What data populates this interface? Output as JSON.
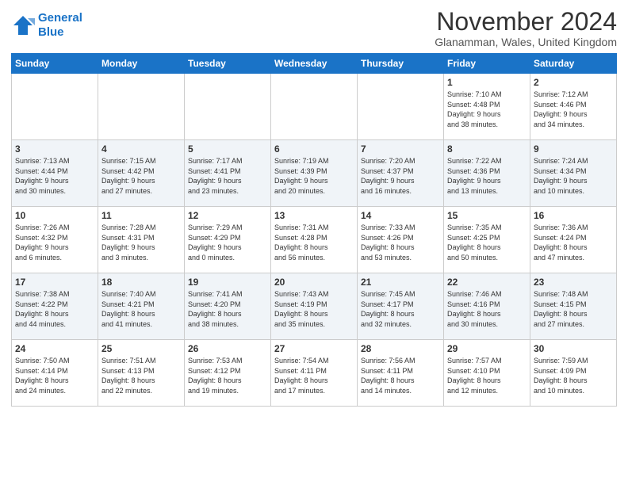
{
  "header": {
    "logo_line1": "General",
    "logo_line2": "Blue",
    "month_title": "November 2024",
    "location": "Glanamman, Wales, United Kingdom"
  },
  "weekdays": [
    "Sunday",
    "Monday",
    "Tuesday",
    "Wednesday",
    "Thursday",
    "Friday",
    "Saturday"
  ],
  "weeks": [
    [
      {
        "day": "",
        "info": ""
      },
      {
        "day": "",
        "info": ""
      },
      {
        "day": "",
        "info": ""
      },
      {
        "day": "",
        "info": ""
      },
      {
        "day": "",
        "info": ""
      },
      {
        "day": "1",
        "info": "Sunrise: 7:10 AM\nSunset: 4:48 PM\nDaylight: 9 hours\nand 38 minutes."
      },
      {
        "day": "2",
        "info": "Sunrise: 7:12 AM\nSunset: 4:46 PM\nDaylight: 9 hours\nand 34 minutes."
      }
    ],
    [
      {
        "day": "3",
        "info": "Sunrise: 7:13 AM\nSunset: 4:44 PM\nDaylight: 9 hours\nand 30 minutes."
      },
      {
        "day": "4",
        "info": "Sunrise: 7:15 AM\nSunset: 4:42 PM\nDaylight: 9 hours\nand 27 minutes."
      },
      {
        "day": "5",
        "info": "Sunrise: 7:17 AM\nSunset: 4:41 PM\nDaylight: 9 hours\nand 23 minutes."
      },
      {
        "day": "6",
        "info": "Sunrise: 7:19 AM\nSunset: 4:39 PM\nDaylight: 9 hours\nand 20 minutes."
      },
      {
        "day": "7",
        "info": "Sunrise: 7:20 AM\nSunset: 4:37 PM\nDaylight: 9 hours\nand 16 minutes."
      },
      {
        "day": "8",
        "info": "Sunrise: 7:22 AM\nSunset: 4:36 PM\nDaylight: 9 hours\nand 13 minutes."
      },
      {
        "day": "9",
        "info": "Sunrise: 7:24 AM\nSunset: 4:34 PM\nDaylight: 9 hours\nand 10 minutes."
      }
    ],
    [
      {
        "day": "10",
        "info": "Sunrise: 7:26 AM\nSunset: 4:32 PM\nDaylight: 9 hours\nand 6 minutes."
      },
      {
        "day": "11",
        "info": "Sunrise: 7:28 AM\nSunset: 4:31 PM\nDaylight: 9 hours\nand 3 minutes."
      },
      {
        "day": "12",
        "info": "Sunrise: 7:29 AM\nSunset: 4:29 PM\nDaylight: 9 hours\nand 0 minutes."
      },
      {
        "day": "13",
        "info": "Sunrise: 7:31 AM\nSunset: 4:28 PM\nDaylight: 8 hours\nand 56 minutes."
      },
      {
        "day": "14",
        "info": "Sunrise: 7:33 AM\nSunset: 4:26 PM\nDaylight: 8 hours\nand 53 minutes."
      },
      {
        "day": "15",
        "info": "Sunrise: 7:35 AM\nSunset: 4:25 PM\nDaylight: 8 hours\nand 50 minutes."
      },
      {
        "day": "16",
        "info": "Sunrise: 7:36 AM\nSunset: 4:24 PM\nDaylight: 8 hours\nand 47 minutes."
      }
    ],
    [
      {
        "day": "17",
        "info": "Sunrise: 7:38 AM\nSunset: 4:22 PM\nDaylight: 8 hours\nand 44 minutes."
      },
      {
        "day": "18",
        "info": "Sunrise: 7:40 AM\nSunset: 4:21 PM\nDaylight: 8 hours\nand 41 minutes."
      },
      {
        "day": "19",
        "info": "Sunrise: 7:41 AM\nSunset: 4:20 PM\nDaylight: 8 hours\nand 38 minutes."
      },
      {
        "day": "20",
        "info": "Sunrise: 7:43 AM\nSunset: 4:19 PM\nDaylight: 8 hours\nand 35 minutes."
      },
      {
        "day": "21",
        "info": "Sunrise: 7:45 AM\nSunset: 4:17 PM\nDaylight: 8 hours\nand 32 minutes."
      },
      {
        "day": "22",
        "info": "Sunrise: 7:46 AM\nSunset: 4:16 PM\nDaylight: 8 hours\nand 30 minutes."
      },
      {
        "day": "23",
        "info": "Sunrise: 7:48 AM\nSunset: 4:15 PM\nDaylight: 8 hours\nand 27 minutes."
      }
    ],
    [
      {
        "day": "24",
        "info": "Sunrise: 7:50 AM\nSunset: 4:14 PM\nDaylight: 8 hours\nand 24 minutes."
      },
      {
        "day": "25",
        "info": "Sunrise: 7:51 AM\nSunset: 4:13 PM\nDaylight: 8 hours\nand 22 minutes."
      },
      {
        "day": "26",
        "info": "Sunrise: 7:53 AM\nSunset: 4:12 PM\nDaylight: 8 hours\nand 19 minutes."
      },
      {
        "day": "27",
        "info": "Sunrise: 7:54 AM\nSunset: 4:11 PM\nDaylight: 8 hours\nand 17 minutes."
      },
      {
        "day": "28",
        "info": "Sunrise: 7:56 AM\nSunset: 4:11 PM\nDaylight: 8 hours\nand 14 minutes."
      },
      {
        "day": "29",
        "info": "Sunrise: 7:57 AM\nSunset: 4:10 PM\nDaylight: 8 hours\nand 12 minutes."
      },
      {
        "day": "30",
        "info": "Sunrise: 7:59 AM\nSunset: 4:09 PM\nDaylight: 8 hours\nand 10 minutes."
      }
    ]
  ]
}
